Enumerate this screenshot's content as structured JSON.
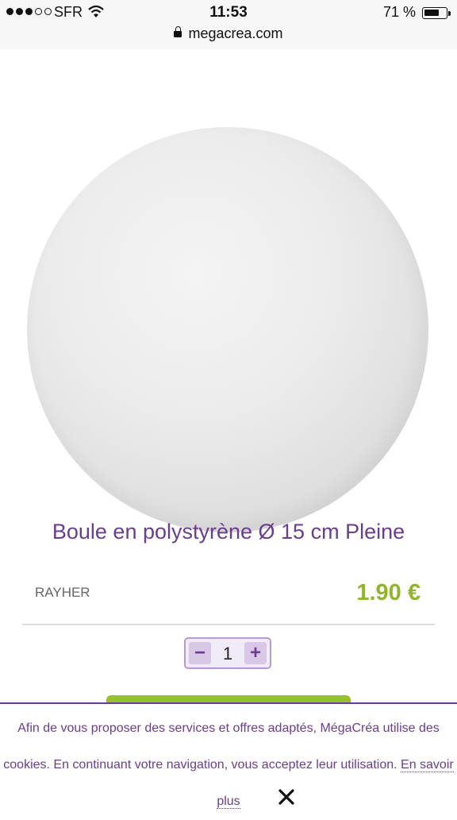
{
  "status_bar": {
    "carrier": "SFR",
    "time": "11:53",
    "battery_percent": "71 %",
    "battery_level": 0.71,
    "signal_bars_filled": 3,
    "signal_bars_total": 5
  },
  "browser": {
    "url": "megacrea.com"
  },
  "product": {
    "title": "Boule en polystyrène Ø 15 cm Pleine",
    "brand": "RAYHER",
    "price": "1.90 €",
    "quantity": "1",
    "minus_label": "−",
    "plus_label": "+"
  },
  "cookie_banner": {
    "text": "Afin de vous proposer des services et offres adaptés, MégaCréa utilise des cookies. En continuant votre navigation, vous acceptez leur utilisation.",
    "link_text": "En savoir plus"
  },
  "colors": {
    "brand_purple": "#6a3d8f",
    "price_green": "#8fb52a",
    "cart_green": "#95c12f"
  }
}
